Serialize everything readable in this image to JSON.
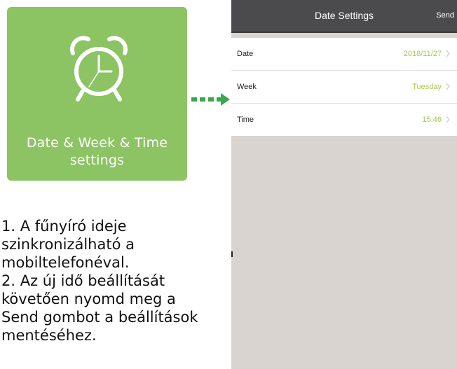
{
  "tile": {
    "icon": "alarm-clock-icon",
    "label_line1": "Date & Week & Time",
    "label_line2": "settings",
    "color": "#8cc463"
  },
  "arrow": {
    "icon": "dashed-arrow-right-icon",
    "color": "#3aa84a"
  },
  "instructions": {
    "lines": [
      "1. A fűnyíró ideje",
      "szinkronizálható a",
      "mobiltelefonéval.",
      "2. Az új idő beállítását",
      "követően nyomd meg a",
      "Send gombot a beállítások",
      "mentéséhez."
    ]
  },
  "phone": {
    "nav": {
      "title": "Date Settings",
      "send_label": "Send",
      "bar_color": "#4b4b4e"
    },
    "rows": [
      {
        "label": "Date",
        "value": "2018/11/27"
      },
      {
        "label": "Week",
        "value": "Tuesday"
      },
      {
        "label": "Time",
        "value": "15:46"
      }
    ],
    "value_color": "#a6c94a",
    "background_color": "#d9d4cf"
  }
}
